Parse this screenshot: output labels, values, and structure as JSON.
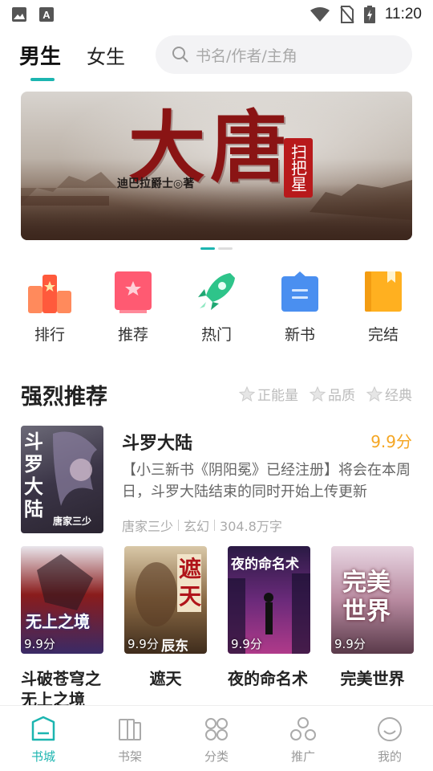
{
  "status_bar": {
    "time": "11:20"
  },
  "header": {
    "tabs": [
      {
        "label": "男生",
        "active": true
      },
      {
        "label": "女生",
        "active": false
      }
    ],
    "search": {
      "placeholder": "书名/作者/主角"
    }
  },
  "banner": {
    "title": "大唐",
    "seal": "扫把星",
    "author": "迪巴拉爵士◎著",
    "page_count": 2,
    "active_page": 1
  },
  "categories": [
    {
      "label": "排行",
      "icon": "ranking-icon",
      "color": "#ff6b4a"
    },
    {
      "label": "推荐",
      "icon": "recommend-icon",
      "color": "#ff5a6e"
    },
    {
      "label": "热门",
      "icon": "rocket-icon",
      "color": "#2ec48a"
    },
    {
      "label": "新书",
      "icon": "new-book-icon",
      "color": "#4a8ff0"
    },
    {
      "label": "完结",
      "icon": "finished-book-icon",
      "color": "#ffb020"
    }
  ],
  "section": {
    "title": "强烈推荐",
    "filters": [
      "正能量",
      "品质",
      "经典"
    ]
  },
  "featured": {
    "title": "斗罗大陆",
    "score": "9.9分",
    "description": "【小三新书《阴阳冕》已经注册】将会在本周日，斗罗大陆结束的同时开始上传更新",
    "author": "唐家三少",
    "genre": "玄幻",
    "words": "304.8万字",
    "cover_text": "斗罗大陆",
    "cover_author": "唐家三少"
  },
  "books": [
    {
      "title": "斗破苍穹之无上之境",
      "score": "9.9分",
      "cover_text": "无上之境"
    },
    {
      "title": "遮天",
      "score": "9.9分",
      "cover_text": "遮天",
      "cover_author": "辰东"
    },
    {
      "title": "夜的命名术",
      "score": "9.9分",
      "cover_text": "夜的命名术"
    },
    {
      "title": "完美世界",
      "score": "9.9分",
      "cover_text": "完美世界"
    }
  ],
  "bottom_nav": [
    {
      "label": "书城",
      "icon": "bookstore-icon",
      "active": true
    },
    {
      "label": "书架",
      "icon": "bookshelf-icon",
      "active": false
    },
    {
      "label": "分类",
      "icon": "category-icon",
      "active": false
    },
    {
      "label": "推广",
      "icon": "promote-icon",
      "active": false
    },
    {
      "label": "我的",
      "icon": "profile-icon",
      "active": false
    }
  ],
  "colors": {
    "accent": "#1cb5b0",
    "score": "#f5a623"
  }
}
